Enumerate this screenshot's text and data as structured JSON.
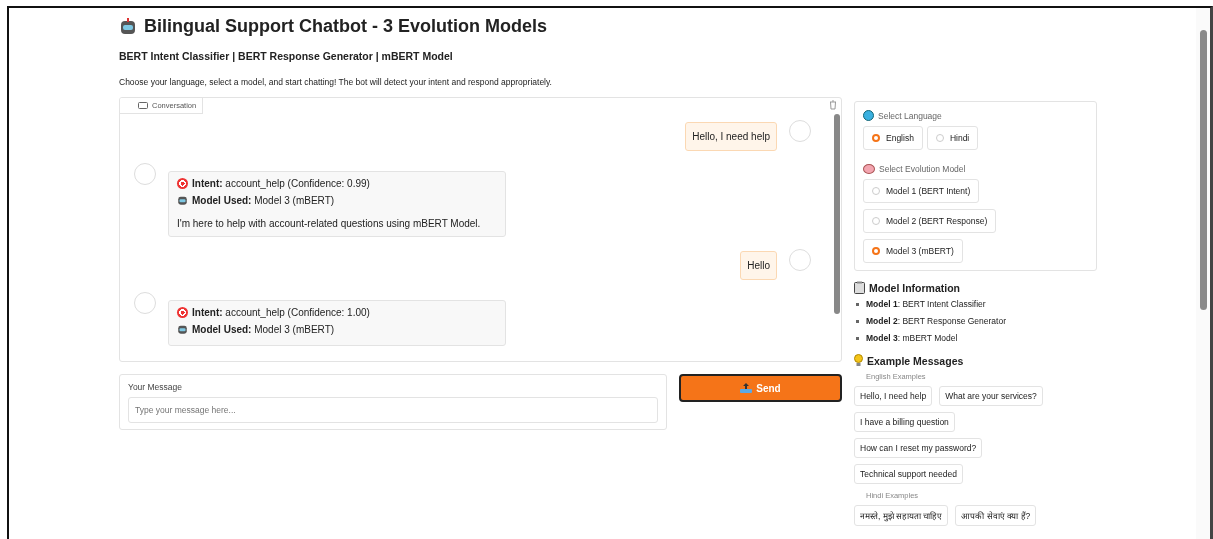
{
  "header": {
    "title": "Bilingual Support Chatbot - 3 Evolution Models",
    "subtitle": "BERT Intent Classifier | BERT Response Generator | mBERT Model",
    "description": "Choose your language, select a model, and start chatting! The bot will detect your intent and respond appropriately."
  },
  "chat": {
    "label": "Conversation",
    "messages": [
      {
        "kind": "user",
        "text": "Hello, I need help"
      },
      {
        "kind": "bot",
        "intent": "**Intent:** account_help (Confidence: 0.99)",
        "model": "**Model Used:** Model 3 (mBERT)",
        "text": "I'm here to help with account-related questions using mBERT Model."
      },
      {
        "kind": "user",
        "text": "Hello"
      },
      {
        "kind": "bot",
        "intent": "**Intent:** account_help (Confidence: 1.00)",
        "model": "**Model Used:** Model 3 (mBERT)"
      }
    ]
  },
  "input": {
    "label": "Your Message",
    "placeholder": "Type your message here..."
  },
  "send_button": "Send",
  "language": {
    "label": "Select Language",
    "options": [
      {
        "label": "English",
        "selected": true
      },
      {
        "label": "Hindi",
        "selected": false
      }
    ]
  },
  "model_select": {
    "label": "Select Evolution Model",
    "options": [
      {
        "label": "Model 1 (BERT Intent)",
        "selected": false
      },
      {
        "label": "Model 2 (BERT Response)",
        "selected": false
      },
      {
        "label": "Model 3 (mBERT)",
        "selected": true
      }
    ]
  },
  "model_info": {
    "title": "Model Information",
    "items": [
      "**Model 1**: BERT Intent Classifier",
      "**Model 2**: BERT Response Generator",
      "**Model 3**: mBERT Model"
    ]
  },
  "examples": {
    "title": "Example Messages",
    "groups": [
      {
        "label": "English Examples",
        "items": [
          "Hello, I need help",
          "What are your services?",
          "I have a billing question",
          "How can I reset my password?",
          "Technical support needed"
        ]
      },
      {
        "label": "Hindi Examples",
        "items": [
          "नमस्ते, मुझे सहायता चाहिए",
          "आपकी सेवाएं क्या हैं?"
        ]
      }
    ]
  }
}
